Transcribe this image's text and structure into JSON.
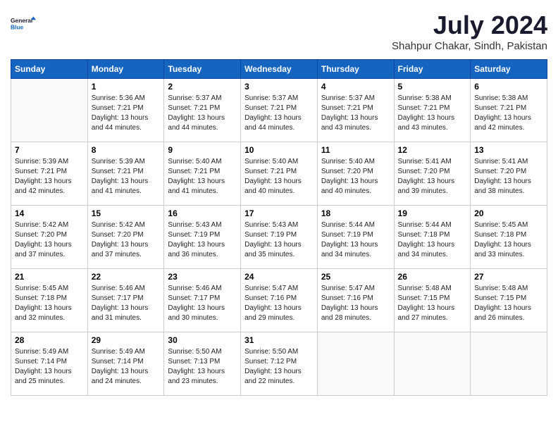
{
  "header": {
    "logo_line1": "General",
    "logo_line2": "Blue",
    "month_year": "July 2024",
    "location": "Shahpur Chakar, Sindh, Pakistan"
  },
  "weekdays": [
    "Sunday",
    "Monday",
    "Tuesday",
    "Wednesday",
    "Thursday",
    "Friday",
    "Saturday"
  ],
  "weeks": [
    [
      {
        "day": "",
        "info": ""
      },
      {
        "day": "1",
        "info": "Sunrise: 5:36 AM\nSunset: 7:21 PM\nDaylight: 13 hours\nand 44 minutes."
      },
      {
        "day": "2",
        "info": "Sunrise: 5:37 AM\nSunset: 7:21 PM\nDaylight: 13 hours\nand 44 minutes."
      },
      {
        "day": "3",
        "info": "Sunrise: 5:37 AM\nSunset: 7:21 PM\nDaylight: 13 hours\nand 44 minutes."
      },
      {
        "day": "4",
        "info": "Sunrise: 5:37 AM\nSunset: 7:21 PM\nDaylight: 13 hours\nand 43 minutes."
      },
      {
        "day": "5",
        "info": "Sunrise: 5:38 AM\nSunset: 7:21 PM\nDaylight: 13 hours\nand 43 minutes."
      },
      {
        "day": "6",
        "info": "Sunrise: 5:38 AM\nSunset: 7:21 PM\nDaylight: 13 hours\nand 42 minutes."
      }
    ],
    [
      {
        "day": "7",
        "info": "Sunrise: 5:39 AM\nSunset: 7:21 PM\nDaylight: 13 hours\nand 42 minutes."
      },
      {
        "day": "8",
        "info": "Sunrise: 5:39 AM\nSunset: 7:21 PM\nDaylight: 13 hours\nand 41 minutes."
      },
      {
        "day": "9",
        "info": "Sunrise: 5:40 AM\nSunset: 7:21 PM\nDaylight: 13 hours\nand 41 minutes."
      },
      {
        "day": "10",
        "info": "Sunrise: 5:40 AM\nSunset: 7:21 PM\nDaylight: 13 hours\nand 40 minutes."
      },
      {
        "day": "11",
        "info": "Sunrise: 5:40 AM\nSunset: 7:20 PM\nDaylight: 13 hours\nand 40 minutes."
      },
      {
        "day": "12",
        "info": "Sunrise: 5:41 AM\nSunset: 7:20 PM\nDaylight: 13 hours\nand 39 minutes."
      },
      {
        "day": "13",
        "info": "Sunrise: 5:41 AM\nSunset: 7:20 PM\nDaylight: 13 hours\nand 38 minutes."
      }
    ],
    [
      {
        "day": "14",
        "info": "Sunrise: 5:42 AM\nSunset: 7:20 PM\nDaylight: 13 hours\nand 37 minutes."
      },
      {
        "day": "15",
        "info": "Sunrise: 5:42 AM\nSunset: 7:20 PM\nDaylight: 13 hours\nand 37 minutes."
      },
      {
        "day": "16",
        "info": "Sunrise: 5:43 AM\nSunset: 7:19 PM\nDaylight: 13 hours\nand 36 minutes."
      },
      {
        "day": "17",
        "info": "Sunrise: 5:43 AM\nSunset: 7:19 PM\nDaylight: 13 hours\nand 35 minutes."
      },
      {
        "day": "18",
        "info": "Sunrise: 5:44 AM\nSunset: 7:19 PM\nDaylight: 13 hours\nand 34 minutes."
      },
      {
        "day": "19",
        "info": "Sunrise: 5:44 AM\nSunset: 7:18 PM\nDaylight: 13 hours\nand 34 minutes."
      },
      {
        "day": "20",
        "info": "Sunrise: 5:45 AM\nSunset: 7:18 PM\nDaylight: 13 hours\nand 33 minutes."
      }
    ],
    [
      {
        "day": "21",
        "info": "Sunrise: 5:45 AM\nSunset: 7:18 PM\nDaylight: 13 hours\nand 32 minutes."
      },
      {
        "day": "22",
        "info": "Sunrise: 5:46 AM\nSunset: 7:17 PM\nDaylight: 13 hours\nand 31 minutes."
      },
      {
        "day": "23",
        "info": "Sunrise: 5:46 AM\nSunset: 7:17 PM\nDaylight: 13 hours\nand 30 minutes."
      },
      {
        "day": "24",
        "info": "Sunrise: 5:47 AM\nSunset: 7:16 PM\nDaylight: 13 hours\nand 29 minutes."
      },
      {
        "day": "25",
        "info": "Sunrise: 5:47 AM\nSunset: 7:16 PM\nDaylight: 13 hours\nand 28 minutes."
      },
      {
        "day": "26",
        "info": "Sunrise: 5:48 AM\nSunset: 7:15 PM\nDaylight: 13 hours\nand 27 minutes."
      },
      {
        "day": "27",
        "info": "Sunrise: 5:48 AM\nSunset: 7:15 PM\nDaylight: 13 hours\nand 26 minutes."
      }
    ],
    [
      {
        "day": "28",
        "info": "Sunrise: 5:49 AM\nSunset: 7:14 PM\nDaylight: 13 hours\nand 25 minutes."
      },
      {
        "day": "29",
        "info": "Sunrise: 5:49 AM\nSunset: 7:14 PM\nDaylight: 13 hours\nand 24 minutes."
      },
      {
        "day": "30",
        "info": "Sunrise: 5:50 AM\nSunset: 7:13 PM\nDaylight: 13 hours\nand 23 minutes."
      },
      {
        "day": "31",
        "info": "Sunrise: 5:50 AM\nSunset: 7:12 PM\nDaylight: 13 hours\nand 22 minutes."
      },
      {
        "day": "",
        "info": ""
      },
      {
        "day": "",
        "info": ""
      },
      {
        "day": "",
        "info": ""
      }
    ]
  ]
}
